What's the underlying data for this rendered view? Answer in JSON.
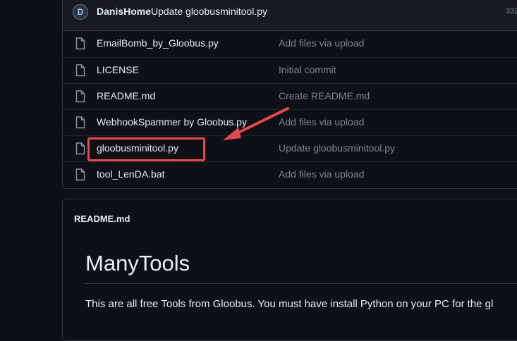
{
  "commit": {
    "avatar_letter": "D",
    "author": "DanisHome",
    "message": "Update gloobusminitool.py",
    "hash_partial": "332"
  },
  "files": [
    {
      "name": "EmailBomb_by_Gloobus.py",
      "commit": "Add files via upload",
      "icon": "file-icon"
    },
    {
      "name": "LICENSE",
      "commit": "Initial commit",
      "icon": "file-icon"
    },
    {
      "name": "README.md",
      "commit": "Create README.md",
      "icon": "file-icon"
    },
    {
      "name": "WebhookSpammer by Gloobus.py",
      "commit": "Add files via upload",
      "icon": "file-icon"
    },
    {
      "name": "gloobusminitool.py",
      "commit": "Update gloobusminitool.py",
      "icon": "file-icon"
    },
    {
      "name": "tool_LenDA.bat",
      "commit": "Add files via upload",
      "icon": "file-icon"
    }
  ],
  "annotation": {
    "color": "#e5484d"
  },
  "readme": {
    "header": "README.md",
    "title": "ManyTools",
    "text": "This are all free Tools from Gloobus. You must have install Python on your PC for the gl"
  },
  "colors": {
    "background": "#0d1117",
    "border": "#30363d",
    "muted": "#7d8590",
    "annotation": "#e5484d"
  }
}
